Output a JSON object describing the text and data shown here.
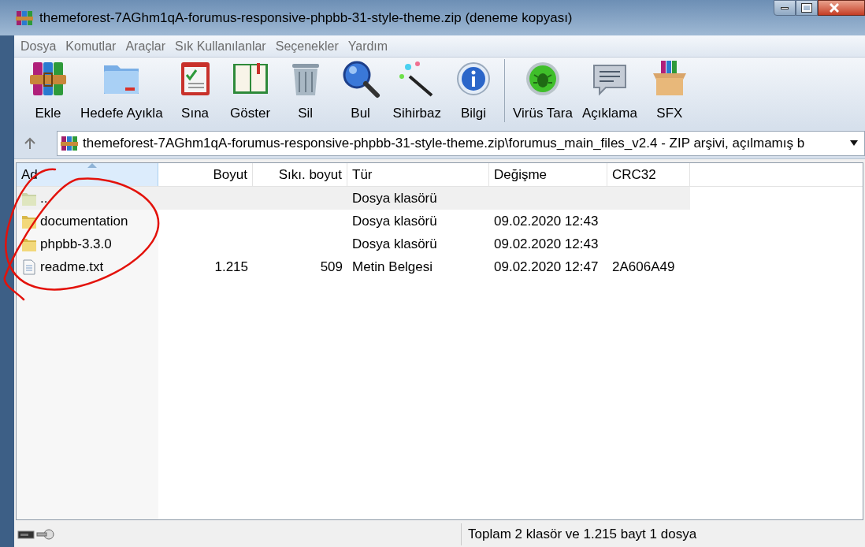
{
  "window": {
    "title": "themeforest-7AGhm1qA-forumus-responsive-phpbb-31-style-theme.zip (deneme kopyası)"
  },
  "menu": [
    "Dosya",
    "Komutlar",
    "Araçlar",
    "Sık Kullanılanlar",
    "Seçenekler",
    "Yardım"
  ],
  "toolbar": [
    {
      "label": "Ekle"
    },
    {
      "label": "Hedefe Ayıkla"
    },
    {
      "label": "Sına"
    },
    {
      "label": "Göster"
    },
    {
      "label": "Sil"
    },
    {
      "label": "Bul"
    },
    {
      "label": "Sihirbaz"
    },
    {
      "label": "Bilgi"
    },
    {
      "label": "Virüs Tara"
    },
    {
      "label": "Açıklama"
    },
    {
      "label": "SFX"
    }
  ],
  "address": {
    "value": "themeforest-7AGhm1qA-forumus-responsive-phpbb-31-style-theme.zip\\forumus_main_files_v2.4 - ZIP arşivi, açılmamış b"
  },
  "table": {
    "columns": [
      {
        "label": "Ad",
        "sorted": true
      },
      {
        "label": "Boyut",
        "sorted": false
      },
      {
        "label": "Sıkı. boyut",
        "sorted": false
      },
      {
        "label": "Tür",
        "sorted": false
      },
      {
        "label": "Değişme",
        "sorted": false
      },
      {
        "label": "CRC32",
        "sorted": false
      }
    ],
    "rows": [
      {
        "kind": "parent",
        "selected": true,
        "cells": [
          "..",
          "",
          "",
          "Dosya klasörü",
          "",
          ""
        ]
      },
      {
        "kind": "folder",
        "selected": false,
        "cells": [
          "documentation",
          "",
          "",
          "Dosya klasörü",
          "09.02.2020 12:43",
          ""
        ]
      },
      {
        "kind": "folder",
        "selected": false,
        "cells": [
          "phpbb-3.3.0",
          "",
          "",
          "Dosya klasörü",
          "09.02.2020 12:43",
          ""
        ]
      },
      {
        "kind": "file",
        "selected": false,
        "cells": [
          "readme.txt",
          "1.215",
          "509",
          "Metin Belgesi",
          "09.02.2020 12:47",
          "2A606A49"
        ]
      }
    ]
  },
  "status_bar": {
    "text": "Toplam 2 klasör ve 1.215 bayt 1 dosya"
  }
}
